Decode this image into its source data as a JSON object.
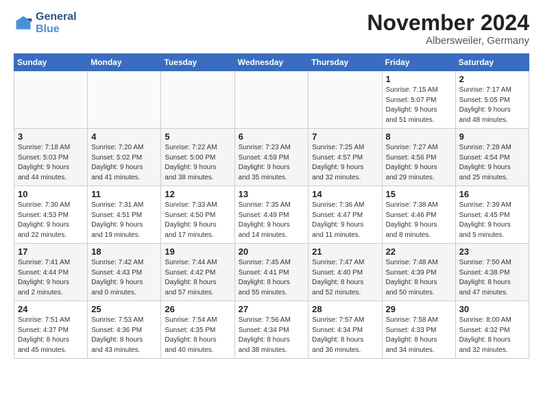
{
  "header": {
    "logo_line1": "General",
    "logo_line2": "Blue",
    "month": "November 2024",
    "location": "Albersweiler, Germany"
  },
  "days_of_week": [
    "Sunday",
    "Monday",
    "Tuesday",
    "Wednesday",
    "Thursday",
    "Friday",
    "Saturday"
  ],
  "weeks": [
    [
      {
        "day": "",
        "info": ""
      },
      {
        "day": "",
        "info": ""
      },
      {
        "day": "",
        "info": ""
      },
      {
        "day": "",
        "info": ""
      },
      {
        "day": "",
        "info": ""
      },
      {
        "day": "1",
        "info": "Sunrise: 7:15 AM\nSunset: 5:07 PM\nDaylight: 9 hours\nand 51 minutes."
      },
      {
        "day": "2",
        "info": "Sunrise: 7:17 AM\nSunset: 5:05 PM\nDaylight: 9 hours\nand 48 minutes."
      }
    ],
    [
      {
        "day": "3",
        "info": "Sunrise: 7:18 AM\nSunset: 5:03 PM\nDaylight: 9 hours\nand 44 minutes."
      },
      {
        "day": "4",
        "info": "Sunrise: 7:20 AM\nSunset: 5:02 PM\nDaylight: 9 hours\nand 41 minutes."
      },
      {
        "day": "5",
        "info": "Sunrise: 7:22 AM\nSunset: 5:00 PM\nDaylight: 9 hours\nand 38 minutes."
      },
      {
        "day": "6",
        "info": "Sunrise: 7:23 AM\nSunset: 4:59 PM\nDaylight: 9 hours\nand 35 minutes."
      },
      {
        "day": "7",
        "info": "Sunrise: 7:25 AM\nSunset: 4:57 PM\nDaylight: 9 hours\nand 32 minutes."
      },
      {
        "day": "8",
        "info": "Sunrise: 7:27 AM\nSunset: 4:56 PM\nDaylight: 9 hours\nand 29 minutes."
      },
      {
        "day": "9",
        "info": "Sunrise: 7:28 AM\nSunset: 4:54 PM\nDaylight: 9 hours\nand 25 minutes."
      }
    ],
    [
      {
        "day": "10",
        "info": "Sunrise: 7:30 AM\nSunset: 4:53 PM\nDaylight: 9 hours\nand 22 minutes."
      },
      {
        "day": "11",
        "info": "Sunrise: 7:31 AM\nSunset: 4:51 PM\nDaylight: 9 hours\nand 19 minutes."
      },
      {
        "day": "12",
        "info": "Sunrise: 7:33 AM\nSunset: 4:50 PM\nDaylight: 9 hours\nand 17 minutes."
      },
      {
        "day": "13",
        "info": "Sunrise: 7:35 AM\nSunset: 4:49 PM\nDaylight: 9 hours\nand 14 minutes."
      },
      {
        "day": "14",
        "info": "Sunrise: 7:36 AM\nSunset: 4:47 PM\nDaylight: 9 hours\nand 11 minutes."
      },
      {
        "day": "15",
        "info": "Sunrise: 7:38 AM\nSunset: 4:46 PM\nDaylight: 9 hours\nand 8 minutes."
      },
      {
        "day": "16",
        "info": "Sunrise: 7:39 AM\nSunset: 4:45 PM\nDaylight: 9 hours\nand 5 minutes."
      }
    ],
    [
      {
        "day": "17",
        "info": "Sunrise: 7:41 AM\nSunset: 4:44 PM\nDaylight: 9 hours\nand 2 minutes."
      },
      {
        "day": "18",
        "info": "Sunrise: 7:42 AM\nSunset: 4:43 PM\nDaylight: 9 hours\nand 0 minutes."
      },
      {
        "day": "19",
        "info": "Sunrise: 7:44 AM\nSunset: 4:42 PM\nDaylight: 8 hours\nand 57 minutes."
      },
      {
        "day": "20",
        "info": "Sunrise: 7:45 AM\nSunset: 4:41 PM\nDaylight: 8 hours\nand 55 minutes."
      },
      {
        "day": "21",
        "info": "Sunrise: 7:47 AM\nSunset: 4:40 PM\nDaylight: 8 hours\nand 52 minutes."
      },
      {
        "day": "22",
        "info": "Sunrise: 7:48 AM\nSunset: 4:39 PM\nDaylight: 8 hours\nand 50 minutes."
      },
      {
        "day": "23",
        "info": "Sunrise: 7:50 AM\nSunset: 4:38 PM\nDaylight: 8 hours\nand 47 minutes."
      }
    ],
    [
      {
        "day": "24",
        "info": "Sunrise: 7:51 AM\nSunset: 4:37 PM\nDaylight: 8 hours\nand 45 minutes."
      },
      {
        "day": "25",
        "info": "Sunrise: 7:53 AM\nSunset: 4:36 PM\nDaylight: 8 hours\nand 43 minutes."
      },
      {
        "day": "26",
        "info": "Sunrise: 7:54 AM\nSunset: 4:35 PM\nDaylight: 8 hours\nand 40 minutes."
      },
      {
        "day": "27",
        "info": "Sunrise: 7:56 AM\nSunset: 4:34 PM\nDaylight: 8 hours\nand 38 minutes."
      },
      {
        "day": "28",
        "info": "Sunrise: 7:57 AM\nSunset: 4:34 PM\nDaylight: 8 hours\nand 36 minutes."
      },
      {
        "day": "29",
        "info": "Sunrise: 7:58 AM\nSunset: 4:33 PM\nDaylight: 8 hours\nand 34 minutes."
      },
      {
        "day": "30",
        "info": "Sunrise: 8:00 AM\nSunset: 4:32 PM\nDaylight: 8 hours\nand 32 minutes."
      }
    ]
  ]
}
